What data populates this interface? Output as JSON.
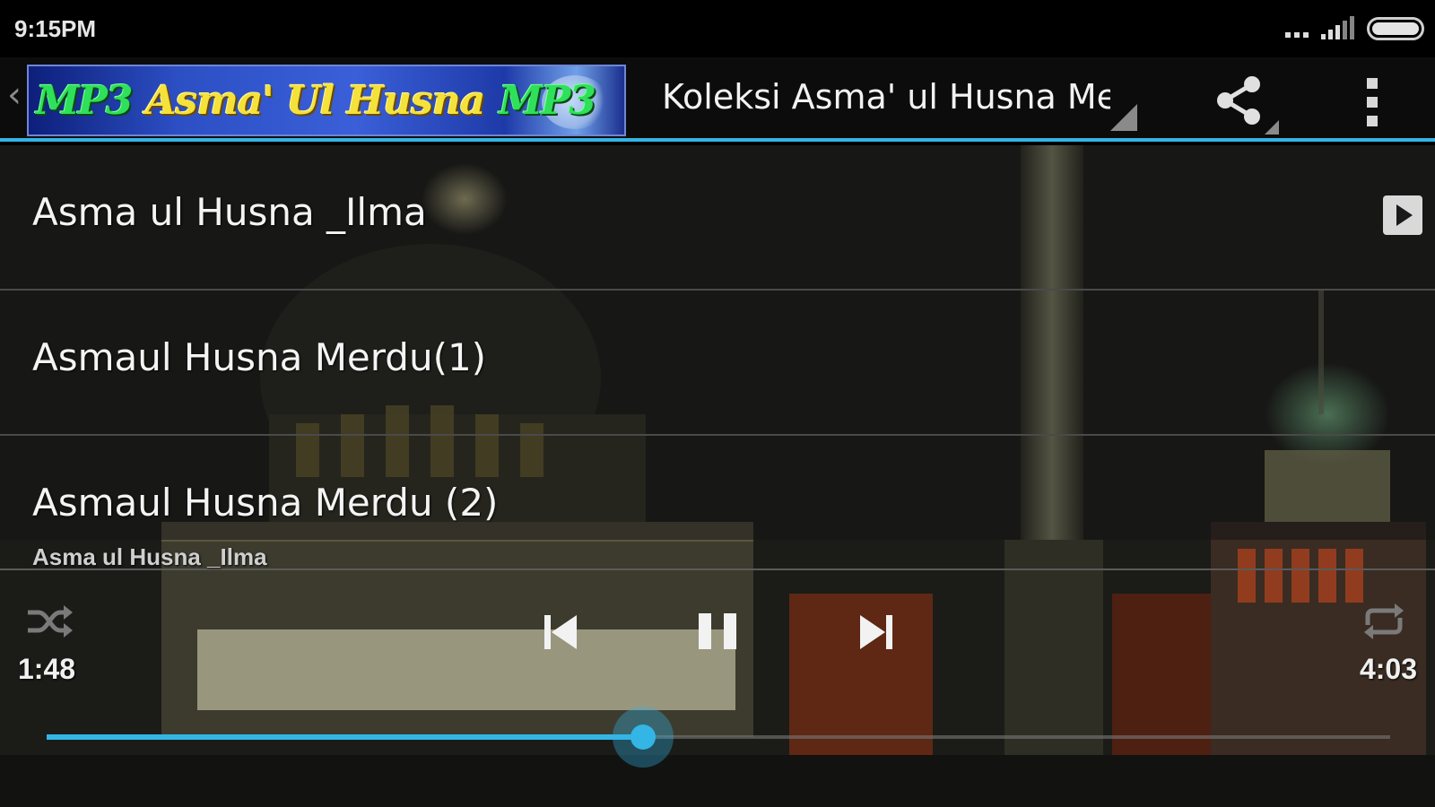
{
  "status_bar": {
    "time": "9:15PM"
  },
  "action_bar": {
    "logo": {
      "left_badge": "MP3",
      "text": "Asma' Ul Husna",
      "right_badge": "MP3"
    },
    "title": "Koleksi Asma' ul Husna Merdu",
    "icons": [
      "chevron-left-icon",
      "share-icon",
      "overflow-menu-icon"
    ]
  },
  "playlist": {
    "tracks": [
      {
        "title": "Asma ul Husna _Ilma",
        "playing": true
      },
      {
        "title": "Asmaul Husna Merdu(1)",
        "playing": false
      },
      {
        "title": "Asmaul Husna Merdu (2)",
        "playing": false
      }
    ]
  },
  "player": {
    "now_playing": "Asma ul Husna _Ilma",
    "elapsed": "1:48",
    "duration": "4:03",
    "progress": 0.444,
    "icons": [
      "shuffle-icon",
      "previous-icon",
      "pause-icon",
      "next-icon",
      "repeat-icon"
    ]
  },
  "colors": {
    "accent": "#33b5e5",
    "action_bar": "#0c0c0c",
    "status_bar": "#000000"
  }
}
